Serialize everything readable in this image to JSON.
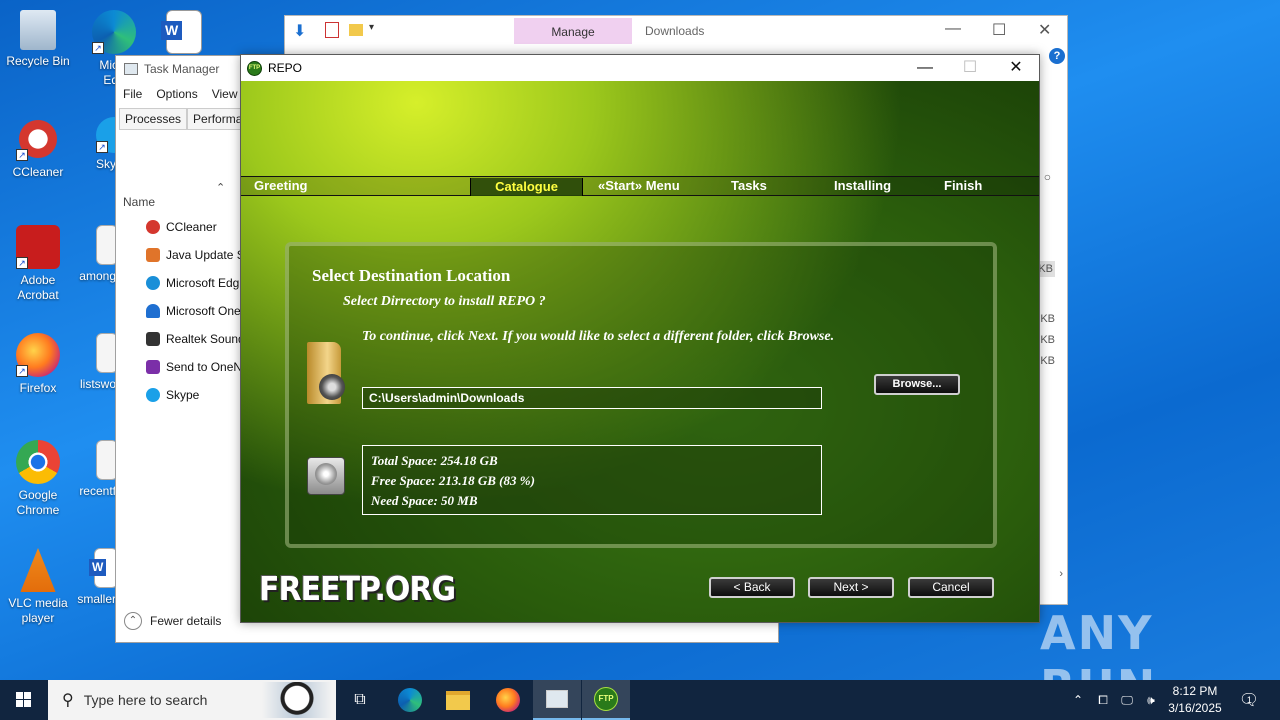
{
  "desktop": {
    "icons": [
      {
        "label": "Recycle Bin"
      },
      {
        "label": "CCleaner"
      },
      {
        "label": "Adobe Acrobat"
      },
      {
        "label": "Firefox"
      },
      {
        "label": "Google Chrome"
      },
      {
        "label": "VLC media player"
      },
      {
        "label": "Micro Edg"
      },
      {
        "label": "Sky"
      },
      {
        "label": "among"
      },
      {
        "label": "listswo"
      },
      {
        "label": "recentf"
      },
      {
        "label": "smaller"
      }
    ]
  },
  "explorer": {
    "manage_tab": "Manage",
    "title": "Downloads",
    "help": "?",
    "sizes": [
      "KB",
      "KB",
      "KB",
      "KB"
    ]
  },
  "task_manager": {
    "title": "Task Manager",
    "menu": [
      "File",
      "Options",
      "View"
    ],
    "tabs": [
      "Processes",
      "Performan"
    ],
    "column_name": "Name",
    "processes": [
      {
        "name": "CCleaner",
        "color": "#d4372e"
      },
      {
        "name": "Java Update Sc",
        "color": "#e0742a"
      },
      {
        "name": "Microsoft Edg",
        "color": "#1a8fd8"
      },
      {
        "name": "Microsoft One",
        "color": "#1f6fd1"
      },
      {
        "name": "Realtek Sound",
        "color": "#333333"
      },
      {
        "name": "Send to OneN",
        "color": "#7b2fa8"
      },
      {
        "name": "Skype",
        "color": "#1aa0e8"
      }
    ],
    "fewer_details": "Fewer details"
  },
  "installer": {
    "title": "REPO",
    "icon_text": "FTP",
    "steps": [
      {
        "label": "Greeting",
        "active": false
      },
      {
        "label": "Catalogue",
        "active": true
      },
      {
        "label": "«Start» Menu",
        "active": false
      },
      {
        "label": "Tasks",
        "active": false
      },
      {
        "label": "Installing",
        "active": false
      },
      {
        "label": "Finish",
        "active": false
      }
    ],
    "heading": "Select Destination Location",
    "subheading": "Select Dirrectory to install REPO ?",
    "info": "To continue, click Next. If you would like to select a different folder, click Browse.",
    "path": "C:\\Users\\admin\\Downloads",
    "browse_label": "Browse...",
    "total_space": "Total Space: 254.18 GB",
    "free_space": "Free Space: 213.18 GB (83 %)",
    "need_space": "Need Space: 50 MB",
    "brand": "FREETP.ORG",
    "back_label": "< Back",
    "next_label": "Next >",
    "cancel_label": "Cancel"
  },
  "watermark": "ANY RUN",
  "taskbar": {
    "search_placeholder": "Type here to search",
    "time": "8:12 PM",
    "date": "3/16/2025",
    "notification_count": "1"
  }
}
